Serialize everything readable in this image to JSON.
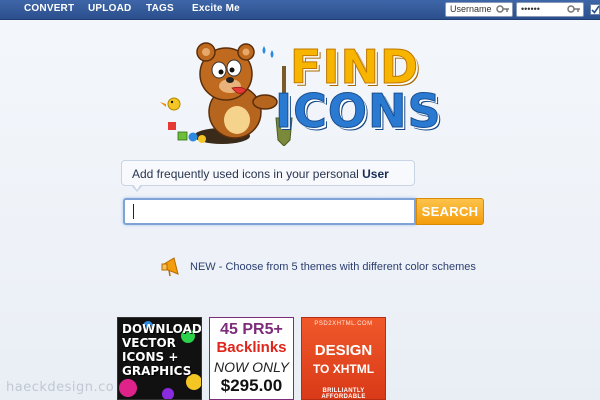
{
  "nav": {
    "items": [
      {
        "label": "CONVERT"
      },
      {
        "label": "UPLOAD"
      },
      {
        "label": "TAGS"
      },
      {
        "label": "Excite Me"
      }
    ]
  },
  "login": {
    "username_value": "Username",
    "password_value": "••••••"
  },
  "logo": {
    "line1": "FIND",
    "line2": "ICONS"
  },
  "bubble": {
    "text": "Add frequently used icons in your personal ",
    "highlight": "User"
  },
  "search": {
    "input_value": "",
    "button_label": "SEARCH"
  },
  "news": {
    "text": "NEW - Choose from 5 themes with different color schemes"
  },
  "ads": {
    "ad1": {
      "lines": [
        "DOWNLOAD",
        "VECTOR",
        "ICONS +",
        "GRAPHICS"
      ]
    },
    "ad2": {
      "l1": "45 PR5+",
      "l2": "Backlinks",
      "l3": "NOW ONLY",
      "l4": "$295.00"
    },
    "ad3": {
      "top": "PSD2XHTML.COM",
      "l1": "DESIGN",
      "l2": "TO XHTML",
      "l3": "BRILLIANTLY AFFORDABLE"
    }
  },
  "watermark": "haeckdesign.co",
  "colors": {
    "nav_bg": "#2c4f8d",
    "search_button": "#f49d0c",
    "logo_find": "#f7b500",
    "logo_icons": "#2b7ad1"
  },
  "icons": [
    "key-icon",
    "checkbox-icon",
    "bear-mascot",
    "megaphone-icon"
  ]
}
